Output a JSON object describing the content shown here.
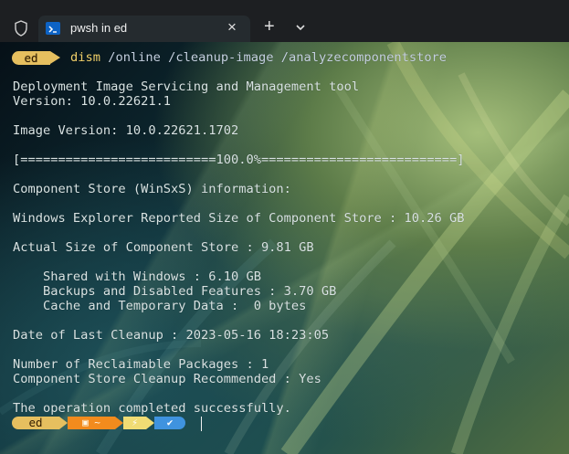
{
  "window": {
    "tab_title": "pwsh in ed",
    "tab_close": "×",
    "new_tab": "+",
    "icons": [
      "shield-icon",
      "terminal-icon",
      "close-icon",
      "plus-icon",
      "chevron-down-icon"
    ]
  },
  "prompt": {
    "user": "ed",
    "command": "dism",
    "args": " /online /cleanup-image /analyzecomponentstore"
  },
  "output": {
    "line1": "Deployment Image Servicing and Management tool",
    "line2": "Version: 10.0.22621.1",
    "line3": "Image Version: 10.0.22621.1702",
    "line4": "[==========================100.0%==========================]",
    "line5": "Component Store (WinSxS) information:",
    "line6": "Windows Explorer Reported Size of Component Store : 10.26 GB",
    "line7": "Actual Size of Component Store : 9.81 GB",
    "line8": "    Shared with Windows : 6.10 GB",
    "line9": "    Backups and Disabled Features : 3.70 GB",
    "line10": "    Cache and Temporary Data :  0 bytes",
    "line11": "Date of Last Cleanup : 2023-05-16 18:23:05",
    "line12": "Number of Reclaimable Packages : 1",
    "line13": "Component Store Cleanup Recommended : Yes",
    "line14": "The operation completed successfully."
  },
  "statusline": {
    "user": "ed",
    "folder_symbol": "▣ ~",
    "bolt_symbol": "⚡",
    "check_symbol": "✔"
  },
  "colors": {
    "prompt_yellow": "#e6bf5f",
    "prompt_orange": "#f28b1d",
    "prompt_yellow_light": "#f1dc74",
    "prompt_blue": "#3f93df"
  }
}
